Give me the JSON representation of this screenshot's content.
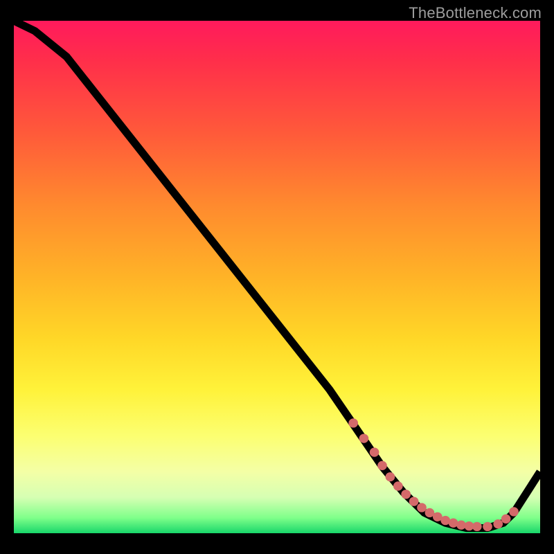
{
  "watermark": "TheBottleneck.com",
  "chart_data": {
    "type": "line",
    "title": "",
    "xlabel": "",
    "ylabel": "",
    "xlim": [
      0,
      100
    ],
    "ylim": [
      0,
      100
    ],
    "grid": false,
    "series": [
      {
        "name": "curve",
        "x": [
          0,
          4,
          10,
          20,
          30,
          40,
          50,
          60,
          66,
          70,
          74,
          78,
          82,
          86,
          90,
          93,
          95,
          100
        ],
        "y": [
          100,
          98,
          93,
          80,
          67,
          54,
          41,
          28,
          19,
          13,
          8,
          4,
          2,
          1,
          1,
          2,
          4,
          12
        ]
      }
    ],
    "markers": {
      "name": "highlight-points",
      "x": [
        64.5,
        66.5,
        68.5,
        70.0,
        71.5,
        73.0,
        74.5,
        76.0,
        77.5,
        79.0,
        80.5,
        82.0,
        83.5,
        85.0,
        86.5,
        88.0,
        90.0,
        92.0,
        93.5,
        95.0
      ],
      "y": [
        21.5,
        18.5,
        15.8,
        13.2,
        11.0,
        9.2,
        7.6,
        6.2,
        5.0,
        4.0,
        3.2,
        2.5,
        2.0,
        1.6,
        1.4,
        1.3,
        1.3,
        1.8,
        2.8,
        4.2
      ]
    },
    "background": "vertical red-to-green gradient"
  }
}
